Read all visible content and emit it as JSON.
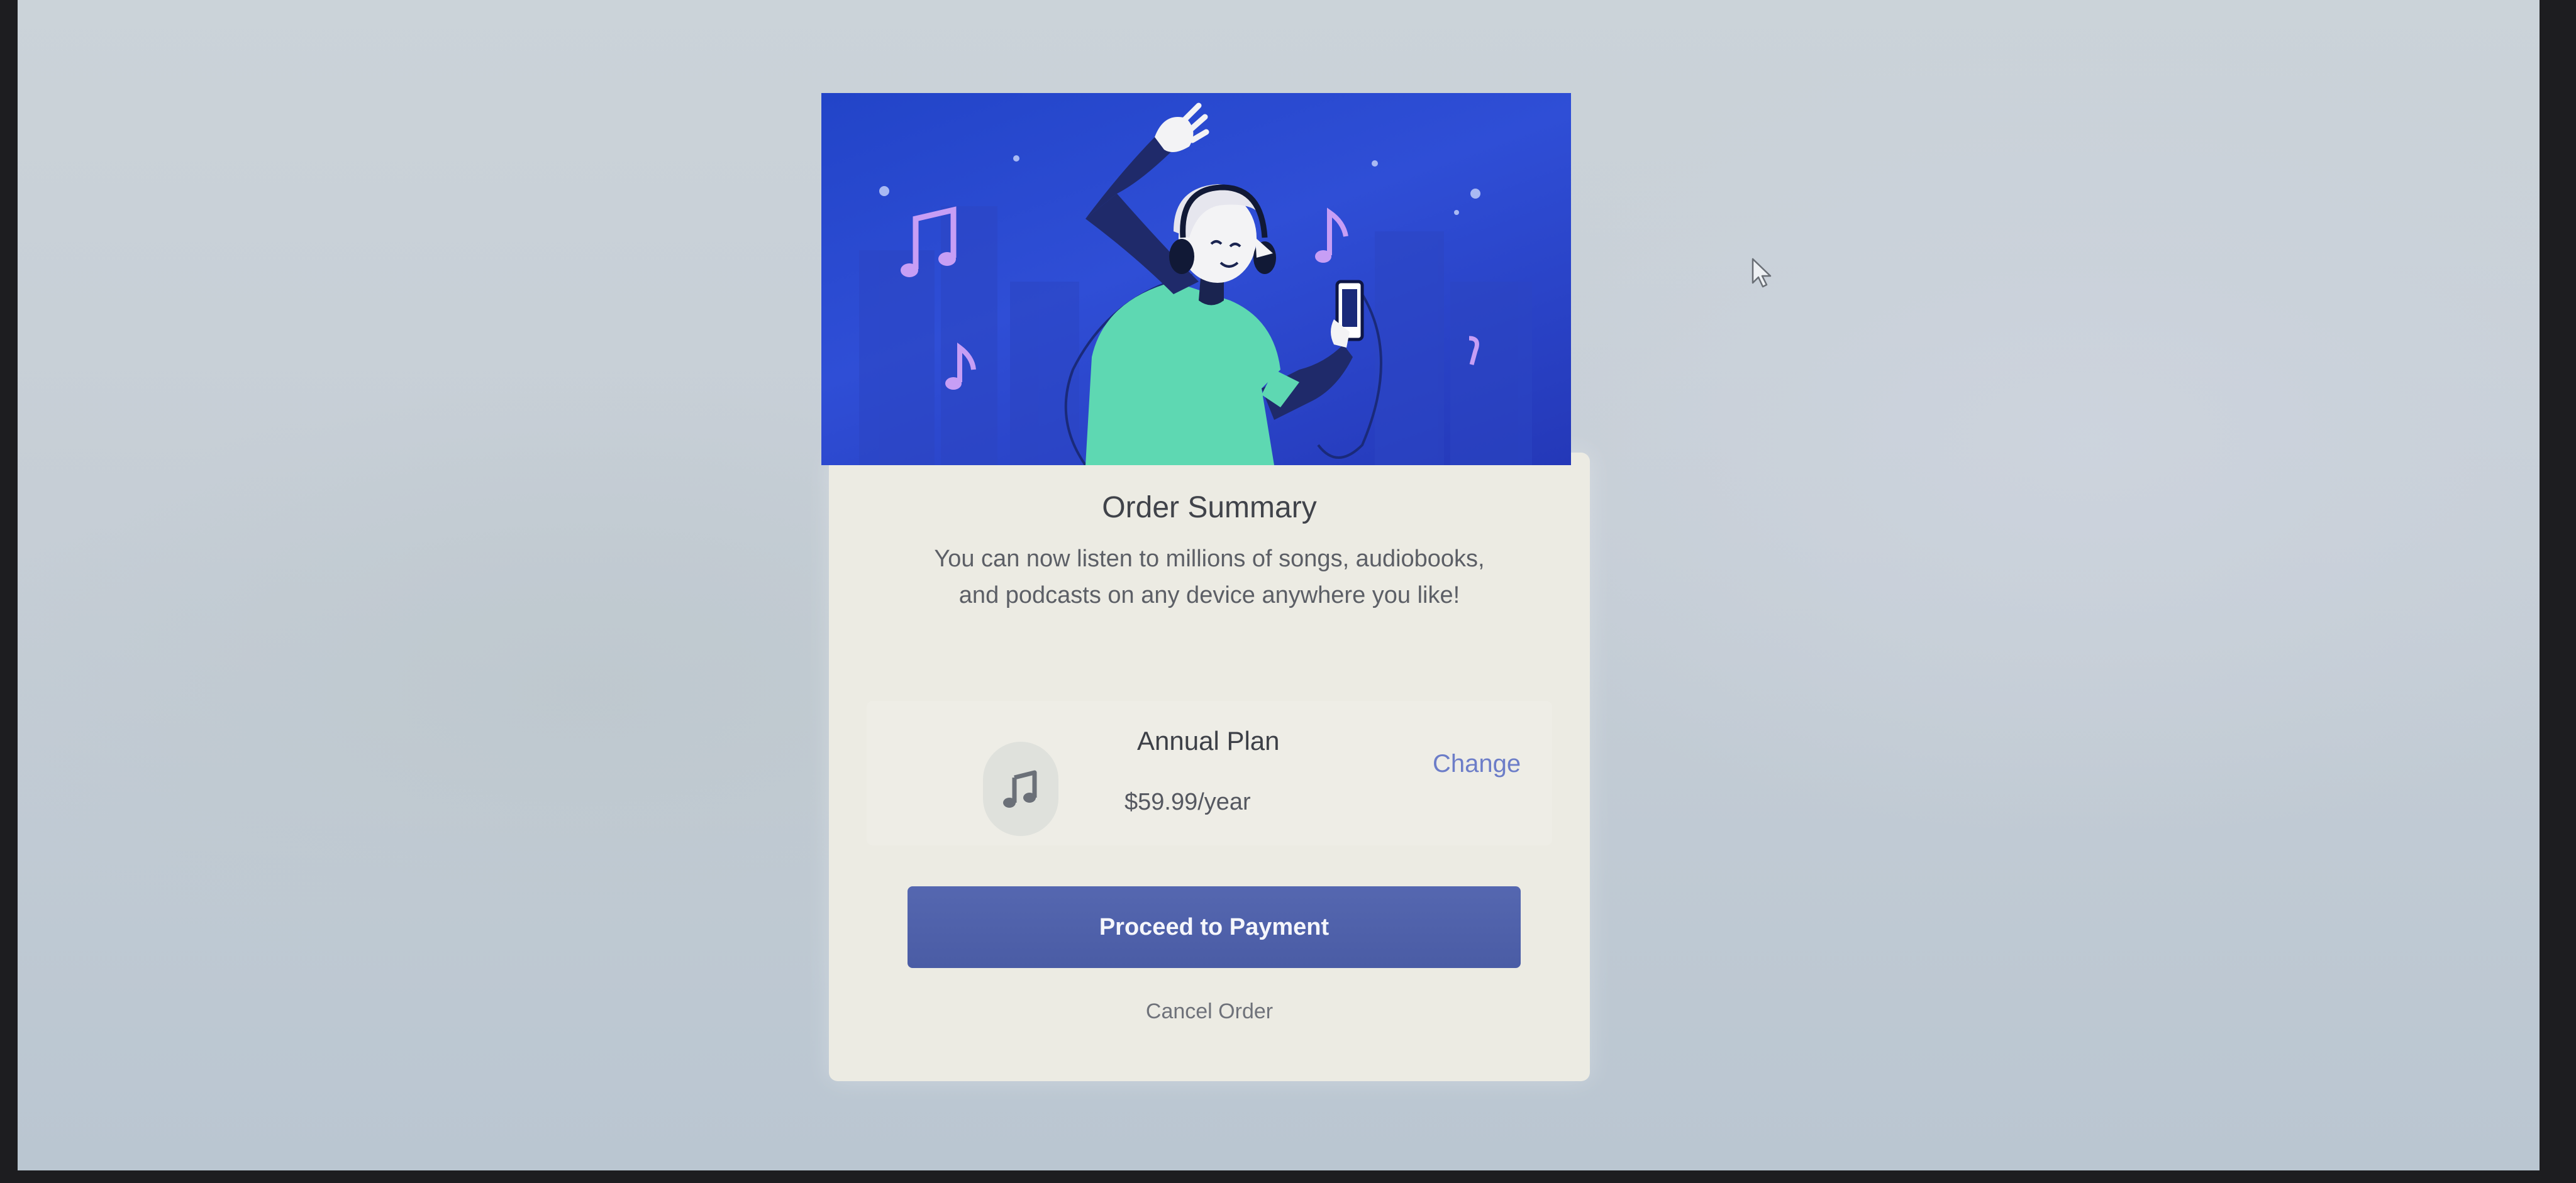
{
  "order": {
    "title": "Order Summary",
    "description": "You can now listen to millions of songs, audiobooks, and podcasts on any device anywhere you like!",
    "illustration_icon": "person-dancing-with-headphones-illustration"
  },
  "plan": {
    "icon": "music-note-icon",
    "name": "Annual Plan",
    "price": "$59.99/year",
    "change_label": "Change"
  },
  "actions": {
    "proceed_label": "Proceed to Payment",
    "cancel_label": "Cancel Order"
  },
  "colors": {
    "hero_background": "#2a48d0",
    "primary_button": "#4f61aa",
    "link": "#6c7dc8",
    "card_background": "#ecebe3"
  }
}
